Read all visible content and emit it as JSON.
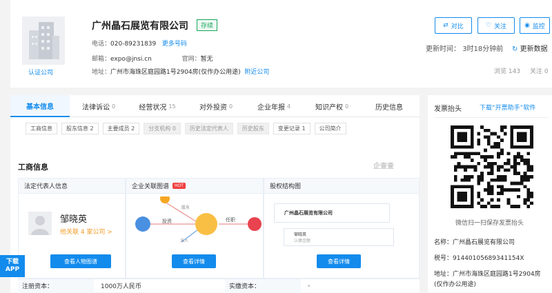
{
  "header": {
    "logo_caption": "认证公司",
    "company_name": "广州晶石展览有限公司",
    "status": "存续",
    "phone_label": "电话：",
    "phone": "020-89231839",
    "more_phone": "更多号码",
    "email_label": "邮箱：",
    "email": "expo@jnsi.cn",
    "website_label": "官网：",
    "website": "暂无",
    "address_label": "地址：",
    "address": "广州市海珠区庭园路1号2904房(仅作办公用途)",
    "nearby": "附近公司",
    "buttons": {
      "compare": "对比",
      "follow": "关注",
      "monitor": "监控"
    },
    "update_label": "更新时间：",
    "update_time": "3时18分钟前",
    "refresh": "更新数据",
    "views_label": "浏览",
    "views": "143",
    "follows_label": "关注",
    "follows": "0"
  },
  "tabs": [
    {
      "label": "基本信息",
      "count": ""
    },
    {
      "label": "法律诉讼",
      "count": "0"
    },
    {
      "label": "经营状况",
      "count": "15"
    },
    {
      "label": "对外投资",
      "count": "0"
    },
    {
      "label": "企业年报",
      "count": "4"
    },
    {
      "label": "知识产权",
      "count": "0"
    },
    {
      "label": "历史信息",
      "count": ""
    }
  ],
  "subtabs": [
    "工商信息",
    "股东信息 2",
    "主要成员 2",
    "分支机构 0",
    "历史法定代表人",
    "历史股东",
    "变更记录 1",
    "公司简介"
  ],
  "section": {
    "title": "工商信息",
    "watermark": "企查查"
  },
  "panels": {
    "legal_rep": {
      "title": "法定代表人信息",
      "name": "邹晓英",
      "related": "他关联 4 家公司 >",
      "button": "查看人物图谱"
    },
    "graph": {
      "title": "企业关联图谱",
      "hot": "HOT",
      "edge_invest": "投资",
      "edge_job": "任职",
      "edge_a": "股东",
      "edge_b": "法人",
      "button": "查看详情"
    },
    "equity": {
      "title": "股权结构图",
      "company": "广州晶石展览有限公司",
      "holder": "邹晓英",
      "holder_sub": "认缴金额",
      "button": "查看详情"
    }
  },
  "table": {
    "capital_label": "注册资本：",
    "capital": "1000万人民币",
    "paid_label": "实缴资本：",
    "paid": "-"
  },
  "sidebar": {
    "title": "发票抬头",
    "download": "下载“开票助手”软件",
    "qr_caption": "微信扫一扫保存发票抬头",
    "name_label": "名称：",
    "name": "广州晶石展览有限公司",
    "tax_label": "税号：",
    "tax": "91440105689341154X",
    "addr_label": "地址：",
    "addr1": "广州市海珠区庭园路1号2904房",
    "addr2": "(仅作办公用途)"
  },
  "float_app": {
    "line1": "下载",
    "line2": "APP"
  },
  "colors": {
    "accent": "#128bed",
    "status": "#19a55a",
    "hot": "#f04040"
  }
}
